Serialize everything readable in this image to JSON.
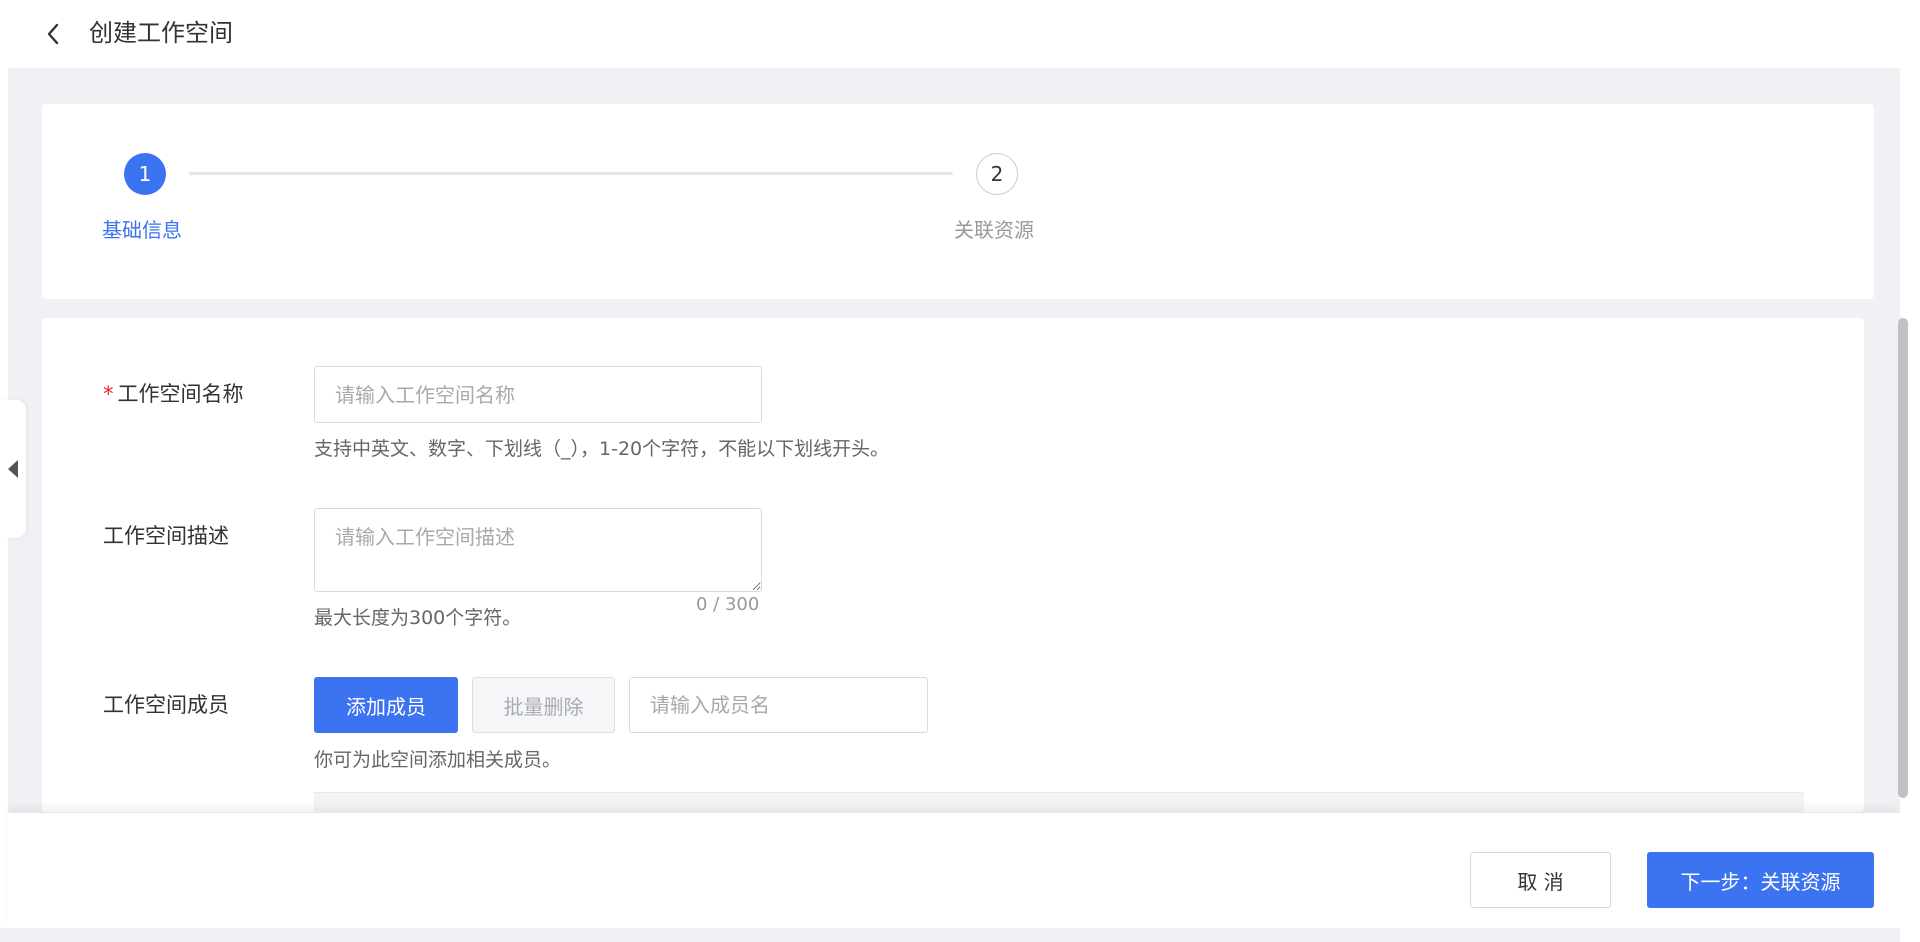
{
  "header": {
    "title": "创建工作空间"
  },
  "steps": [
    {
      "number": "1",
      "label": "基础信息",
      "state": "active"
    },
    {
      "number": "2",
      "label": "关联资源",
      "state": "inactive"
    }
  ],
  "form": {
    "name": {
      "label": "工作空间名称",
      "required_mark": "*",
      "placeholder": "请输入工作空间名称",
      "value": "",
      "hint": "支持中英文、数字、下划线（_），1-20个字符，不能以下划线开头。"
    },
    "description": {
      "label": "工作空间描述",
      "placeholder": "请输入工作空间描述",
      "value": "",
      "counter": "0 / 300",
      "hint": "最大长度为300个字符。"
    },
    "members": {
      "label": "工作空间成员",
      "add_button": "添加成员",
      "batch_delete_button": "批量删除",
      "search_placeholder": "请输入成员名",
      "hint": "你可为此空间添加相关成员。"
    }
  },
  "footer": {
    "cancel_label": "取 消",
    "next_label": "下一步：关联资源"
  },
  "colors": {
    "primary": "#3c73f0",
    "required": "#f5222d",
    "background": "#eff1f4"
  },
  "icons": {
    "back": "chevron-left-icon",
    "collapse": "caret-left-icon",
    "resize": "resize-handle-icon"
  }
}
